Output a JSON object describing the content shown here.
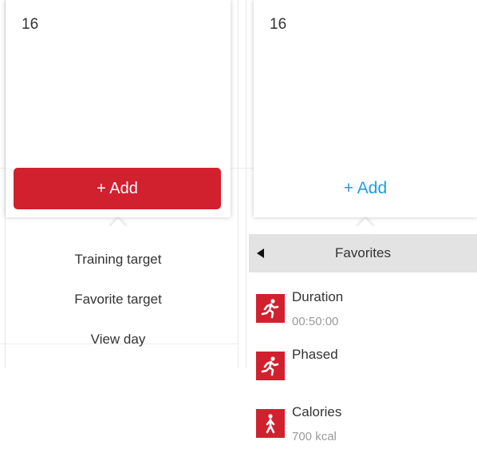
{
  "left_card": {
    "day": "16",
    "add_label": "+ Add",
    "menu": [
      "Training target",
      "Favorite target",
      "View day"
    ]
  },
  "right_card": {
    "day": "16",
    "add_label": "+ Add"
  },
  "favorites": {
    "title": "Favorites",
    "items": [
      {
        "name": "Duration",
        "value": "00:50:00",
        "icon": "running-icon"
      },
      {
        "name": "Phased",
        "value": "",
        "icon": "running-icon"
      },
      {
        "name": "Calories",
        "value": "700 kcal",
        "icon": "walking-icon"
      }
    ]
  },
  "colors": {
    "accent_red": "#d1202e",
    "link_blue": "#1aa0d8",
    "header_gray": "#e3e3e3"
  }
}
